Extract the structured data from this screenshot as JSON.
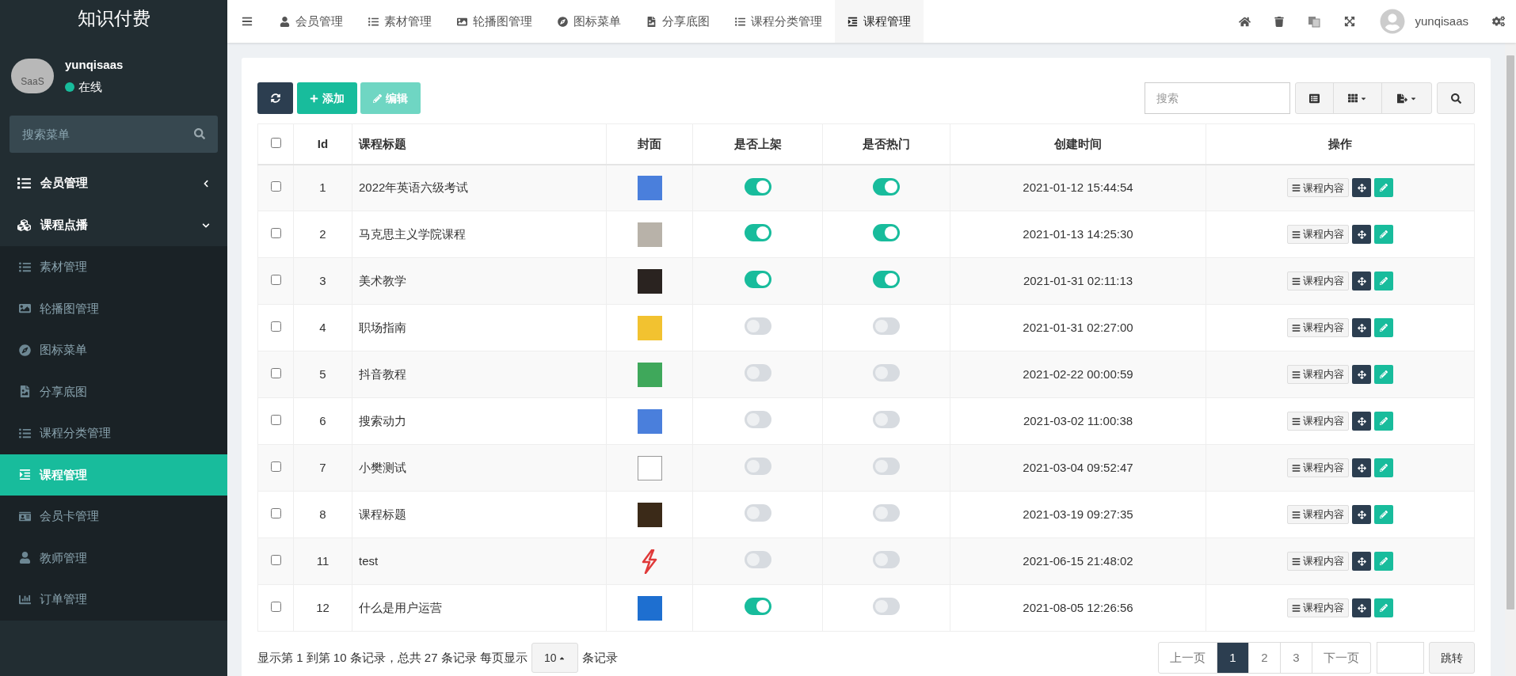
{
  "app_title": "知识付费",
  "user": {
    "name": "yunqisaas",
    "status": "在线",
    "avatar_text": "SaaS"
  },
  "sidebar": {
    "search_placeholder": "搜索菜单",
    "items": [
      {
        "label": "会员管理",
        "expanded": false
      },
      {
        "label": "课程点播",
        "expanded": true,
        "children": [
          {
            "label": "素材管理",
            "selected": false
          },
          {
            "label": "轮播图管理",
            "selected": false
          },
          {
            "label": "图标菜单",
            "selected": false
          },
          {
            "label": "分享底图",
            "selected": false
          },
          {
            "label": "课程分类管理",
            "selected": false
          },
          {
            "label": "课程管理",
            "selected": true
          },
          {
            "label": "会员卡管理",
            "selected": false
          },
          {
            "label": "教师管理",
            "selected": false
          },
          {
            "label": "订单管理",
            "selected": false
          }
        ]
      }
    ]
  },
  "tabs": [
    {
      "label": "会员管理",
      "selected": false
    },
    {
      "label": "素材管理",
      "selected": false
    },
    {
      "label": "轮播图管理",
      "selected": false
    },
    {
      "label": "图标菜单",
      "selected": false
    },
    {
      "label": "分享底图",
      "selected": false
    },
    {
      "label": "课程分类管理",
      "selected": false
    },
    {
      "label": "课程管理",
      "selected": true
    }
  ],
  "top_user": "yunqisaas",
  "toolbar": {
    "add": "添加",
    "edit": "编辑",
    "edit_disabled": true,
    "search_placeholder": "搜索"
  },
  "table": {
    "header_checked": false,
    "columns": [
      "Id",
      "课程标题",
      "封面",
      "是否上架",
      "是否热门",
      "创建时间",
      "操作"
    ],
    "rows": [
      {
        "checked": false,
        "id": "1",
        "title": "2022年英语六级考试",
        "cover": {
          "kind": "photo"
        },
        "published": true,
        "hot": true,
        "created": "2021-01-12 15:44:54",
        "action": "课程内容"
      },
      {
        "checked": false,
        "id": "2",
        "title": "马克思主义学院课程",
        "cover": {
          "kind": "photo"
        },
        "published": true,
        "hot": true,
        "created": "2021-01-13 14:25:30",
        "action": "课程内容"
      },
      {
        "checked": false,
        "id": "3",
        "title": "美术教学",
        "cover": {
          "kind": "photo"
        },
        "published": true,
        "hot": true,
        "created": "2021-01-31 02:11:13",
        "action": "课程内容"
      },
      {
        "checked": false,
        "id": "4",
        "title": "职场指南",
        "cover": {
          "kind": "photo"
        },
        "published": false,
        "hot": false,
        "created": "2021-01-31 02:27:00",
        "action": "课程内容"
      },
      {
        "checked": false,
        "id": "5",
        "title": "抖音教程",
        "cover": {
          "kind": "photo"
        },
        "published": false,
        "hot": false,
        "created": "2021-02-22 00:00:59",
        "action": "课程内容"
      },
      {
        "checked": false,
        "id": "6",
        "title": "搜索动力",
        "cover": {
          "kind": "photo"
        },
        "published": false,
        "hot": false,
        "created": "2021-03-02 11:00:38",
        "action": "课程内容"
      },
      {
        "checked": false,
        "id": "7",
        "title": "小樊测试",
        "cover": {
          "kind": "broken"
        },
        "published": false,
        "hot": false,
        "created": "2021-03-04 09:52:47",
        "action": "课程内容"
      },
      {
        "checked": false,
        "id": "8",
        "title": "课程标题",
        "cover": {
          "kind": "photo"
        },
        "published": false,
        "hot": false,
        "created": "2021-03-19 09:27:35",
        "action": "课程内容"
      },
      {
        "checked": false,
        "id": "11",
        "title": "test",
        "cover": {
          "kind": "logo"
        },
        "published": false,
        "hot": false,
        "created": "2021-06-15 21:48:02",
        "action": "课程内容"
      },
      {
        "checked": false,
        "id": "12",
        "title": "什么是用户运营",
        "cover": {
          "kind": "photo"
        },
        "published": true,
        "hot": false,
        "created": "2021-08-05 12:26:56",
        "action": "课程内容"
      }
    ]
  },
  "pagination": {
    "summary": "显示第 1 到第 10 条记录，总共 27 条记录 每页显示",
    "page_size": "10",
    "suffix": "条记录",
    "prev": "上一页",
    "pages": [
      {
        "label": "1",
        "selected": true
      },
      {
        "label": "2",
        "selected": false
      },
      {
        "label": "3",
        "selected": false
      }
    ],
    "next": "下一页",
    "jump": "跳转"
  }
}
